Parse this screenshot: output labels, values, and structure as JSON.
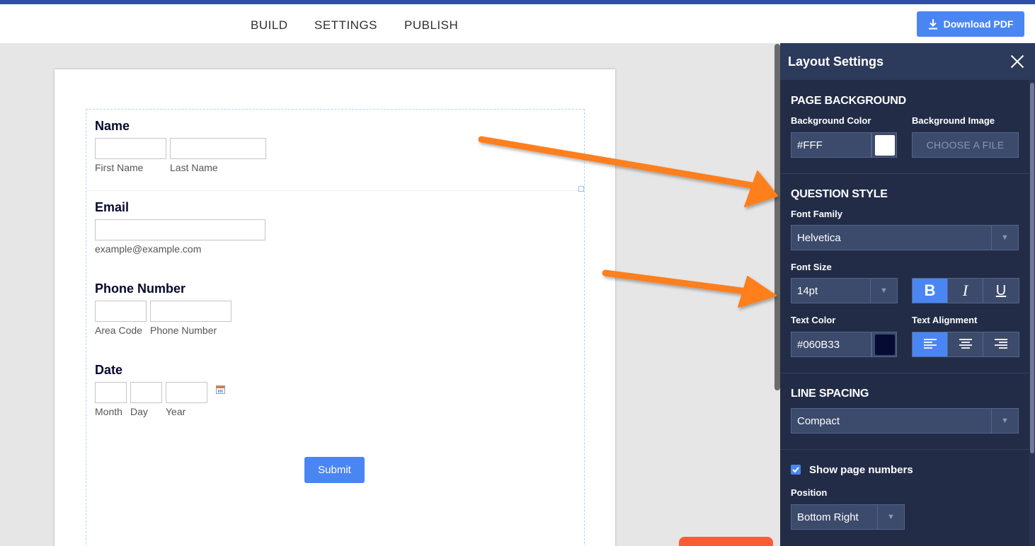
{
  "topbar": {
    "nav": [
      "BUILD",
      "SETTINGS",
      "PUBLISH"
    ],
    "download_label": "Download PDF"
  },
  "form": {
    "name": {
      "label": "Name",
      "sub": [
        "First Name",
        "Last Name"
      ]
    },
    "email": {
      "label": "Email",
      "sub": "example@example.com"
    },
    "phone": {
      "label": "Phone Number",
      "sub": [
        "Area Code",
        "Phone Number"
      ]
    },
    "date": {
      "label": "Date",
      "sub": [
        "Month",
        "Day",
        "Year"
      ]
    },
    "submit_label": "Submit"
  },
  "panel": {
    "title": "Layout Settings",
    "page_background": {
      "title": "PAGE BACKGROUND",
      "color_label": "Background Color",
      "color_value": "#FFF",
      "image_label": "Background Image",
      "file_button": "CHOOSE A FILE"
    },
    "question_style": {
      "title": "QUESTION STYLE",
      "font_family_label": "Font Family",
      "font_family_value": "Helvetica",
      "font_size_label": "Font Size",
      "font_size_value": "14pt",
      "format_buttons": [
        "B",
        "I",
        "U"
      ],
      "text_color_label": "Text Color",
      "text_color_value": "#060B33",
      "text_alignment_label": "Text Alignment"
    },
    "line_spacing": {
      "title": "LINE SPACING",
      "value": "Compact"
    },
    "page_numbers": {
      "checkbox_label": "Show page numbers",
      "checked": true,
      "position_label": "Position",
      "position_value": "Bottom Right"
    }
  },
  "colors": {
    "accent": "#4A86F2",
    "panel_bg": "#222C47",
    "arrow": "#FF7F1E",
    "text_swatch": "#060B33",
    "bg_swatch": "#FFFFFF"
  }
}
